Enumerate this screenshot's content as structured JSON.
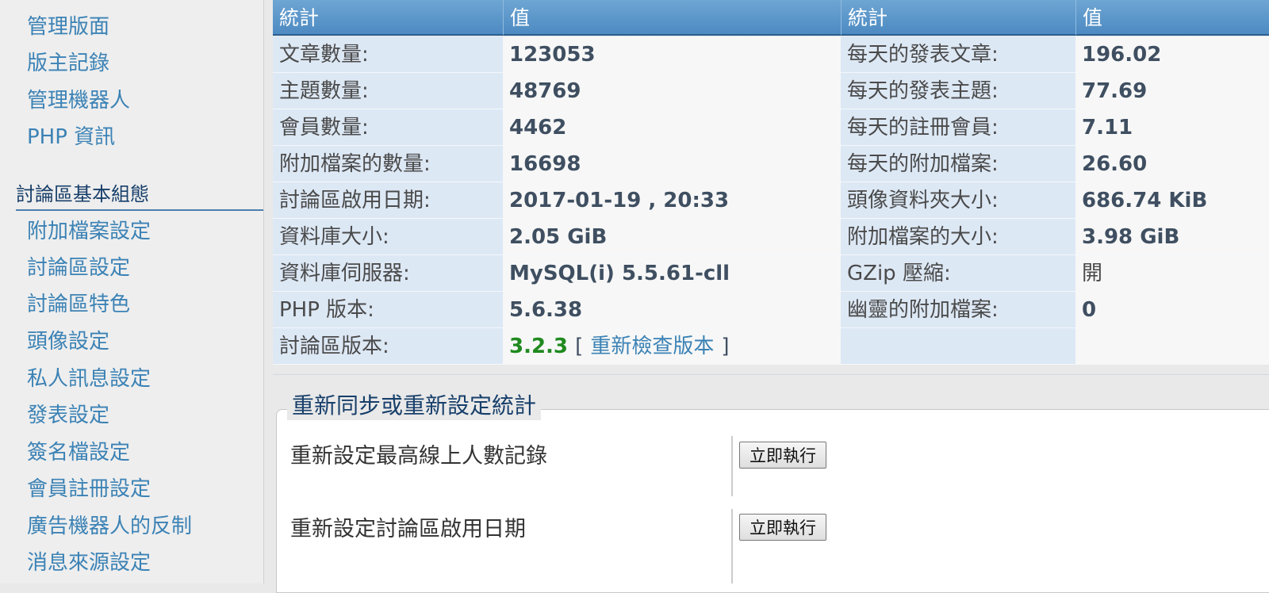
{
  "sidebar": {
    "group1_links": [
      "管理版面",
      "版主記錄",
      "管理機器人",
      "PHP 資訊"
    ],
    "group2_heading": "討論區基本組態",
    "group2_links": [
      "附加檔案設定",
      "討論區設定",
      "討論區特色",
      "頭像設定",
      "私人訊息設定",
      "發表設定",
      "簽名檔設定",
      "會員註冊設定",
      "廣告機器人的反制",
      "消息來源設定"
    ]
  },
  "stats_table": {
    "headers": [
      "統計",
      "值",
      "統計",
      "值"
    ],
    "rows": [
      {
        "label1": "文章數量:",
        "value1": "123053",
        "label2": "每天的發表文章:",
        "value2": "196.02"
      },
      {
        "label1": "主題數量:",
        "value1": "48769",
        "label2": "每天的發表主題:",
        "value2": "77.69"
      },
      {
        "label1": "會員數量:",
        "value1": "4462",
        "label2": "每天的註冊會員:",
        "value2": "7.11"
      },
      {
        "label1": "附加檔案的數量:",
        "value1": "16698",
        "label2": "每天的附加檔案:",
        "value2": "26.60"
      },
      {
        "label1": "討論區啟用日期:",
        "value1": "2017-01-19 , 20:33",
        "label2": "頭像資料夾大小:",
        "value2": "686.74 KiB"
      },
      {
        "label1": "資料庫大小:",
        "value1": "2.05 GiB",
        "label2": "附加檔案的大小:",
        "value2": "3.98 GiB"
      },
      {
        "label1": "資料庫伺服器:",
        "value1": "MySQL(i) 5.5.61-cll",
        "label2": "GZip 壓縮:",
        "value2": "開"
      },
      {
        "label1": "PHP 版本:",
        "value1": "5.6.38",
        "label2": "幽靈的附加檔案:",
        "value2": "0"
      }
    ],
    "version_row": {
      "label": "討論區版本:",
      "version": "3.2.3",
      "bracket_open": "[",
      "recheck_link": "重新檢查版本",
      "bracket_close": "]"
    }
  },
  "resync": {
    "legend": "重新同步或重新設定統計",
    "options": [
      {
        "label": "重新設定最高線上人數記錄",
        "button": "立即執行"
      },
      {
        "label": "重新設定討論區啟用日期",
        "button": "立即執行"
      }
    ]
  },
  "colors": {
    "header_bg": "#5a96c9",
    "label_bg": "#dde8f5",
    "link": "#3b82b5",
    "version_green": "#1f8a1f"
  }
}
